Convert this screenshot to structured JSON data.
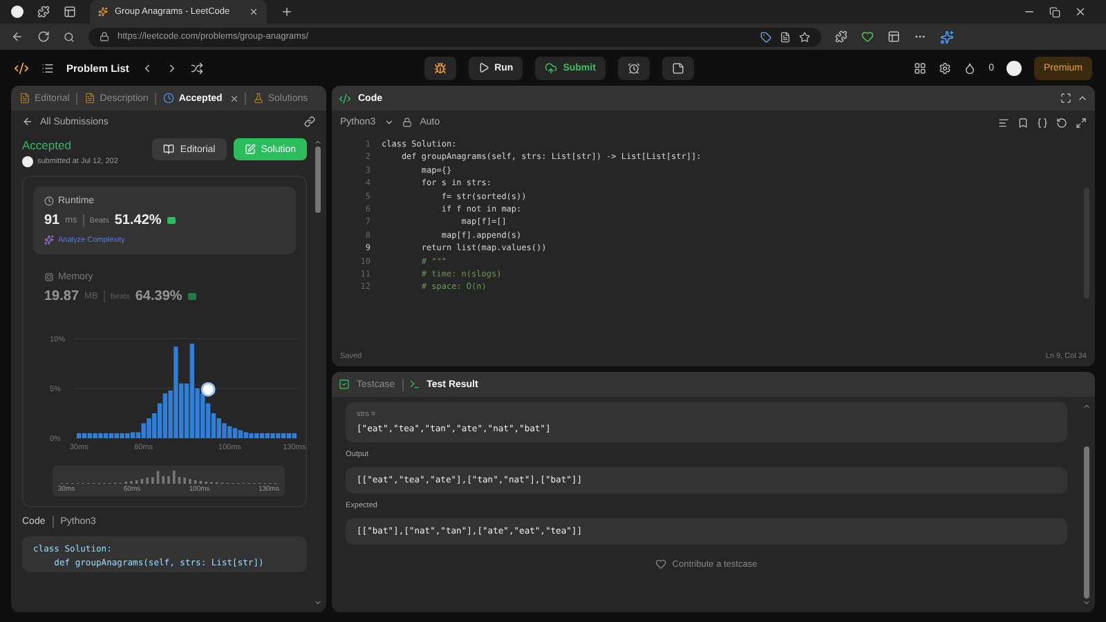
{
  "browser": {
    "tab_title": "Group Anagrams - LeetCode",
    "url": "https://leetcode.com/problems/group-anagrams/"
  },
  "nav": {
    "problem_list": "Problem List",
    "run": "Run",
    "submit": "Submit",
    "streak": "0",
    "premium": "Premium"
  },
  "left_tabs": [
    {
      "label": "Editorial",
      "selected": false,
      "closable": false
    },
    {
      "label": "Description",
      "selected": false,
      "closable": false
    },
    {
      "label": "Accepted",
      "selected": true,
      "closable": true
    },
    {
      "label": "Solutions",
      "selected": false,
      "closable": false
    }
  ],
  "back_link": "All Submissions",
  "submission": {
    "status": "Accepted",
    "submitted": "submitted at Jul 12, 202",
    "editorial_button": "Editorial",
    "solution_button": "Solution"
  },
  "metrics": [
    {
      "kind": "runtime",
      "title": "Runtime",
      "value": "91",
      "unit": "ms",
      "beats_label": "Beats",
      "beats": "51.42%",
      "link": "Analyze Complexity",
      "selected": true
    },
    {
      "kind": "memory",
      "title": "Memory",
      "value": "19.87",
      "unit": "MB",
      "beats_label": "Beats",
      "beats": "64.39%",
      "selected": false
    }
  ],
  "histogram": {
    "chart_data": {
      "type": "bar",
      "x": [
        30,
        32.5,
        35,
        37.5,
        40,
        42.5,
        45,
        47.5,
        50,
        52.5,
        55,
        57.5,
        60,
        62.5,
        65,
        67.5,
        70,
        72.5,
        75,
        77.5,
        80,
        82.5,
        85,
        87.5,
        90,
        92.5,
        95,
        97.5,
        100,
        102.5,
        105,
        107.5,
        110,
        112.5,
        115,
        117.5,
        120,
        122.5,
        125,
        127.5,
        130
      ],
      "series": [
        {
          "color": "#2f7fd8",
          "values": [
            0.5,
            0.5,
            0.5,
            0.5,
            0.5,
            0.5,
            0.5,
            0.5,
            0.5,
            0.5,
            0.6,
            0.6,
            1.5,
            2,
            2.5,
            3.5,
            4.5,
            4.8,
            9.2,
            5.5,
            5.5,
            9.5,
            5,
            4.5,
            3.5,
            2.5,
            2,
            1.5,
            1.2,
            1,
            0.8,
            0.6,
            0.5,
            0.5,
            0.5,
            0.5,
            0.5,
            0.5,
            0.5,
            0.5,
            0.5
          ]
        }
      ],
      "xlim": [
        28,
        132
      ],
      "ylim": [
        0,
        10
      ],
      "xticks": [
        {
          "value": 30,
          "label": "30ms"
        },
        {
          "value": 60,
          "label": "60ms"
        },
        {
          "value": 100,
          "label": "100ms"
        },
        {
          "value": 130,
          "label": "130ms"
        }
      ],
      "yticks": [
        {
          "value": 0,
          "label": "0%"
        },
        {
          "value": 5,
          "label": "5%"
        },
        {
          "value": 10,
          "label": "10%"
        }
      ]
    },
    "overview_labels": [
      "30ms",
      "60ms",
      "100ms",
      "130ms"
    ]
  },
  "submitted_code": {
    "label": "Code",
    "language": "Python3",
    "lines": [
      "class Solution:",
      "    def groupAnagrams(self, strs: List[str])"
    ]
  },
  "editor": {
    "title": "Code",
    "language": "Python3",
    "mode": "Auto",
    "status": "Saved",
    "cursor": "Ln 9, Col 34",
    "lines": [
      {
        "no": "1",
        "text": "class Solution:",
        "kind": "code"
      },
      {
        "no": "2",
        "text": "    def groupAnagrams(self, strs: List[str]) -> List[List[str]]:",
        "kind": "code"
      },
      {
        "no": "3",
        "text": "        map={}",
        "kind": "code"
      },
      {
        "no": "4",
        "text": "        for s in strs:",
        "kind": "code"
      },
      {
        "no": "5",
        "text": "            f= str(sorted(s))",
        "kind": "code"
      },
      {
        "no": "6",
        "text": "            if f not in map:",
        "kind": "code"
      },
      {
        "no": "7",
        "text": "                map[f]=[]",
        "kind": "code"
      },
      {
        "no": "8",
        "text": "            map[f].append(s)",
        "kind": "code"
      },
      {
        "no": "9",
        "text": "        return list(map.values())",
        "kind": "code"
      },
      {
        "no": "10",
        "text": "        # \"\"\"",
        "kind": "comment"
      },
      {
        "no": "11",
        "text": "        # time: n(slogs)",
        "kind": "comment"
      },
      {
        "no": "12",
        "text": "        # space: O(n)",
        "kind": "comment"
      }
    ]
  },
  "test_tabs": [
    {
      "label": "Testcase",
      "selected": false
    },
    {
      "label": "Test Result",
      "selected": true
    }
  ],
  "test_result": {
    "input_label": "strs =",
    "input": "[\"eat\",\"tea\",\"tan\",\"ate\",\"nat\",\"bat\"]",
    "sections": [
      {
        "label": "Output",
        "value": "[[\"eat\",\"tea\",\"ate\"],[\"tan\",\"nat\"],[\"bat\"]]"
      },
      {
        "label": "Expected",
        "value": "[[\"bat\"],[\"nat\",\"tan\"],[\"ate\",\"eat\",\"tea\"]]"
      }
    ],
    "contribute": "Contribute a testcase"
  }
}
